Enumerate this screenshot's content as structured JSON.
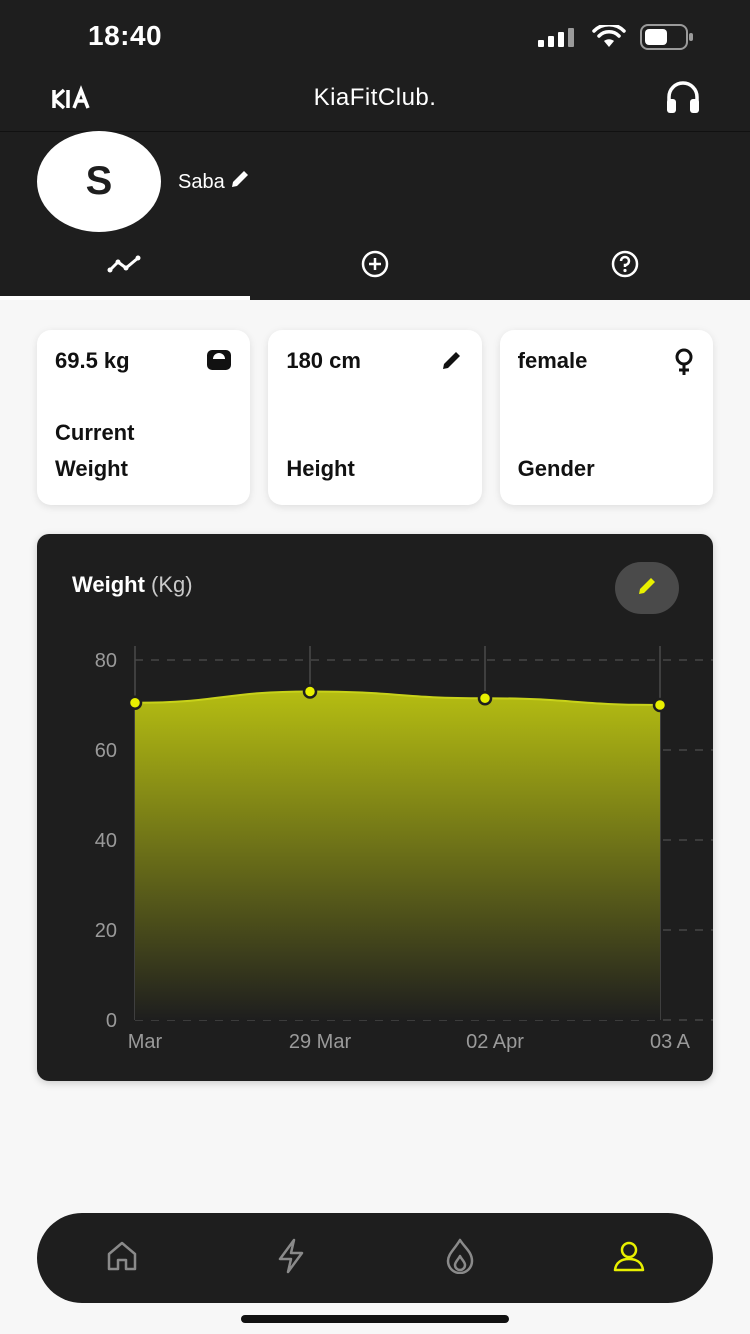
{
  "status_bar": {
    "time": "18:40"
  },
  "app_bar": {
    "title": "KiaFitClub."
  },
  "profile": {
    "initial": "S",
    "name": "Saba"
  },
  "tabs": [
    {
      "icon": "chart-line-icon",
      "active": true
    },
    {
      "icon": "plus-circle-icon",
      "active": false
    },
    {
      "icon": "help-circle-icon",
      "active": false
    }
  ],
  "stats": [
    {
      "value": "69.5 kg",
      "label": "Current Weight",
      "icon": "scale-icon"
    },
    {
      "value": "180 cm",
      "label": "Height",
      "icon": "pencil-icon"
    },
    {
      "value": "female",
      "label": "Gender",
      "icon": "female-icon"
    }
  ],
  "chart": {
    "title": "Weight",
    "unit": "(Kg)"
  },
  "chart_data": {
    "type": "area",
    "title": "Weight (Kg)",
    "categories": [
      "Mar",
      "29 Mar",
      "02 Apr",
      "03 A"
    ],
    "values": [
      70.5,
      73,
      71.5,
      70
    ],
    "ylim": [
      0,
      80
    ],
    "yticks": [
      0,
      20,
      40,
      60,
      80
    ],
    "grid": true,
    "colors": {
      "line": "#c8d21a",
      "point": "#e8f000",
      "fill_top": "#b5bd12"
    }
  },
  "bottom_nav": [
    {
      "icon": "home-icon",
      "active": false
    },
    {
      "icon": "bolt-icon",
      "active": false
    },
    {
      "icon": "flame-icon",
      "active": false
    },
    {
      "icon": "user-icon",
      "active": true
    }
  ],
  "colors": {
    "accent": "#e8f000",
    "dark": "#1e1e1e",
    "background": "#f7f7f7"
  }
}
